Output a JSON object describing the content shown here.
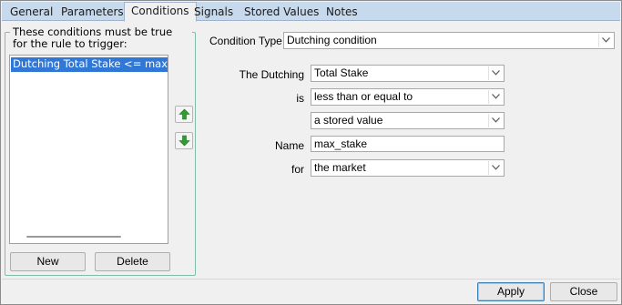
{
  "tabs": [
    {
      "label": "General"
    },
    {
      "label": "Parameters"
    },
    {
      "label": "Conditions"
    },
    {
      "label": "Signals"
    },
    {
      "label": "Stored Values"
    },
    {
      "label": "Notes"
    }
  ],
  "active_tab": "Conditions",
  "conditions_panel": {
    "caption": "These conditions must be true for the rule to trigger:",
    "items": [
      {
        "label": "Dutching Total Stake <= max_stake",
        "selected": true
      }
    ],
    "move_up_icon": "green-up-arrow-icon",
    "move_down_icon": "green-down-arrow-icon",
    "new_label": "New",
    "delete_label": "Delete"
  },
  "form": {
    "condition_type_label": "Condition Type",
    "condition_type_value": "Dutching condition",
    "dutching_label": "The Dutching",
    "dutching_value": "Total Stake",
    "is_label": "is",
    "is_value": "less than or equal to",
    "compare_value": "a stored value",
    "name_label": "Name",
    "name_value": "max_stake",
    "for_label": "for",
    "for_value": "the market"
  },
  "footer": {
    "apply_label": "Apply",
    "close_label": "Close"
  },
  "colors": {
    "tab_bar": "#c7d9ed",
    "selection": "#3178d6",
    "group_border": "#7fbfa6",
    "arrow_green": "#2e9e2e"
  }
}
